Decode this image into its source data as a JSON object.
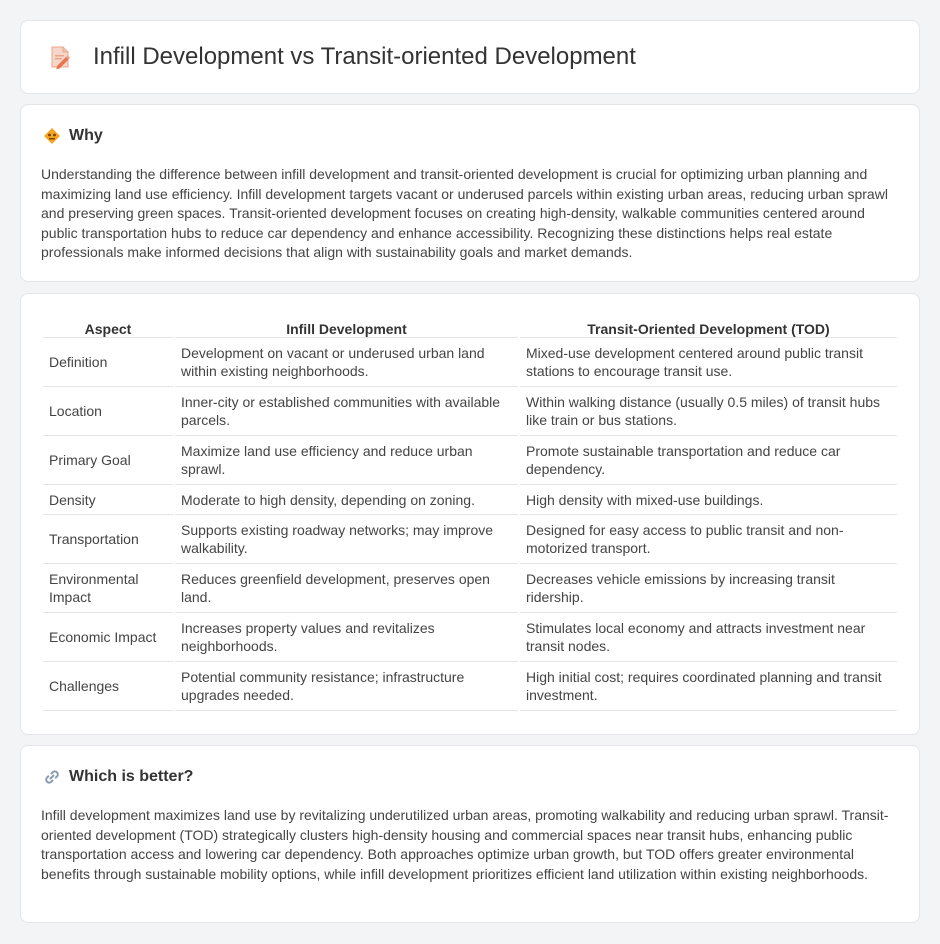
{
  "header": {
    "title": "Infill Development vs Transit-oriented Development",
    "icon": "document-pencil-icon"
  },
  "why": {
    "title": "Why",
    "icon": "warning-diamond-icon",
    "body": "Understanding the difference between infill development and transit-oriented development is crucial for optimizing urban planning and maximizing land use efficiency. Infill development targets vacant or underused parcels within existing urban areas, reducing urban sprawl and preserving green spaces. Transit-oriented development focuses on creating high-density, walkable communities centered around public transportation hubs to reduce car dependency and enhance accessibility. Recognizing these distinctions helps real estate professionals make informed decisions that align with sustainability goals and market demands."
  },
  "table": {
    "headers": [
      "Aspect",
      "Infill Development",
      "Transit-Oriented Development (TOD)"
    ],
    "rows": [
      [
        "Definition",
        "Development on vacant or underused urban land within existing neighborhoods.",
        "Mixed-use development centered around public transit stations to encourage transit use."
      ],
      [
        "Location",
        "Inner-city or established communities with available parcels.",
        "Within walking distance (usually 0.5 miles) of transit hubs like train or bus stations."
      ],
      [
        "Primary Goal",
        "Maximize land use efficiency and reduce urban sprawl.",
        "Promote sustainable transportation and reduce car dependency."
      ],
      [
        "Density",
        "Moderate to high density, depending on zoning.",
        "High density with mixed-use buildings."
      ],
      [
        "Transportation",
        "Supports existing roadway networks; may improve walkability.",
        "Designed for easy access to public transit and non-motorized transport."
      ],
      [
        "Environmental Impact",
        "Reduces greenfield development, preserves open land.",
        "Decreases vehicle emissions by increasing transit ridership."
      ],
      [
        "Economic Impact",
        "Increases property values and revitalizes neighborhoods.",
        "Stimulates local economy and attracts investment near transit nodes."
      ],
      [
        "Challenges",
        "Potential community resistance; infrastructure upgrades needed.",
        "High initial cost; requires coordinated planning and transit investment."
      ]
    ]
  },
  "better": {
    "title": "Which is better?",
    "icon": "link-icon",
    "body": "Infill development maximizes land use by revitalizing underutilized urban areas, promoting walkability and reducing urban sprawl. Transit-oriented development (TOD) strategically clusters high-density housing and commercial spaces near transit hubs, enhancing public transportation access and lowering car dependency. Both approaches optimize urban growth, but TOD offers greater environmental benefits through sustainable mobility options, while infill development prioritizes efficient land utilization within existing neighborhoods."
  }
}
